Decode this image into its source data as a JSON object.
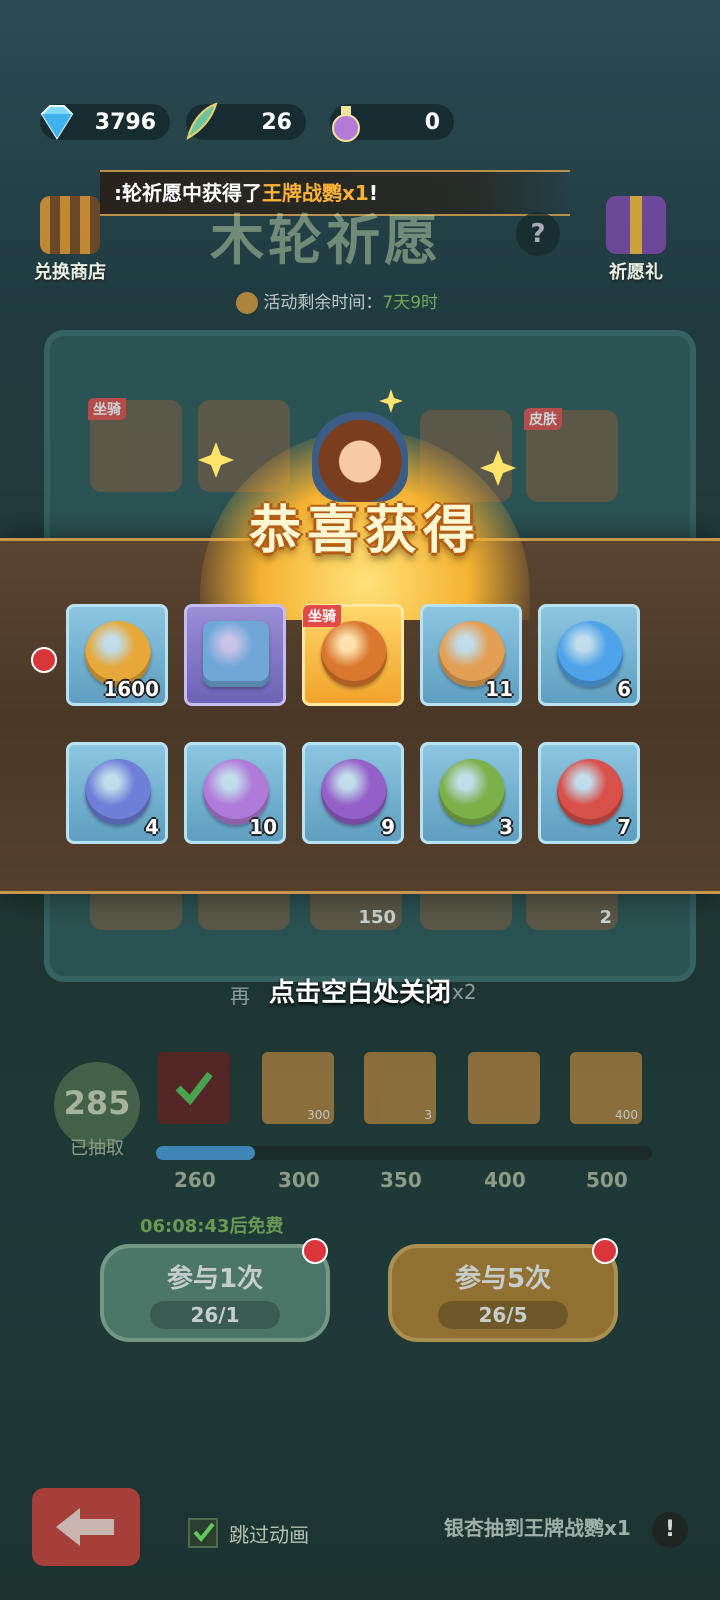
{
  "currencies": [
    {
      "icon": "diamond-icon",
      "value": "3796"
    },
    {
      "icon": "feather-icon",
      "value": "26"
    },
    {
      "icon": "potion-icon",
      "value": "0"
    }
  ],
  "marquee": {
    "prefix": ":轮祈愿中获得了",
    "highlight": "王牌战鹦x1",
    "suffix": "!"
  },
  "left_button": {
    "label": "兑换商店"
  },
  "right_button": {
    "label": "祈愿礼"
  },
  "event_title": "木轮祈愿",
  "timer": {
    "label": "活动剩余时间：",
    "value": "7天9时"
  },
  "reward_title": "恭喜获得",
  "rewards": [
    {
      "name": "coin",
      "count": "1600",
      "style": "blue",
      "color": "#e7a83a"
    },
    {
      "name": "hammer",
      "count": "",
      "style": "purple",
      "color": "#6fa8d8"
    },
    {
      "name": "mount-parrot",
      "count": "",
      "style": "gold",
      "tag": "坐骑",
      "color": "#d9782e"
    },
    {
      "name": "wing-orb",
      "count": "11",
      "style": "blue",
      "color": "#e3a055"
    },
    {
      "name": "swirl-orb",
      "count": "6",
      "style": "blue",
      "color": "#4fa3e8"
    },
    {
      "name": "paw-orb",
      "count": "4",
      "style": "blue",
      "color": "#6f7fd8"
    },
    {
      "name": "eye-orb",
      "count": "10",
      "style": "blue",
      "color": "#b07ad8"
    },
    {
      "name": "hook-orb",
      "count": "9",
      "style": "blue",
      "color": "#9460c8"
    },
    {
      "name": "bow-orb",
      "count": "3",
      "style": "blue",
      "color": "#7cb04a"
    },
    {
      "name": "sword-orb",
      "count": "7",
      "style": "blue",
      "color": "#d8504a"
    }
  ],
  "close_hint": "点击空白处关闭",
  "behind_text": {
    "left": "再",
    "right": "x2"
  },
  "draw_count": {
    "value": "285",
    "label": "已抽取"
  },
  "milestones": [
    {
      "label": "260",
      "reward": "",
      "claimed": true
    },
    {
      "label": "300",
      "reward": "300"
    },
    {
      "label": "350",
      "reward": "3"
    },
    {
      "label": "400",
      "reward": ""
    },
    {
      "label": "500",
      "reward": "400"
    }
  ],
  "progress_fraction": 0.2,
  "free_timer": "06:08:43后免费",
  "btn_one": {
    "label": "参与1次",
    "cost": "26/1"
  },
  "btn_five": {
    "label": "参与5次",
    "cost": "26/5"
  },
  "skip_anim": {
    "label": "跳过动画",
    "checked": true
  },
  "ticker": {
    "line1": "银杏抽到王牌战鹦x1"
  },
  "behind_counts": {
    "c150": "150",
    "c2": "2"
  },
  "tags": {
    "mount": "坐骑",
    "skin": "皮肤"
  }
}
